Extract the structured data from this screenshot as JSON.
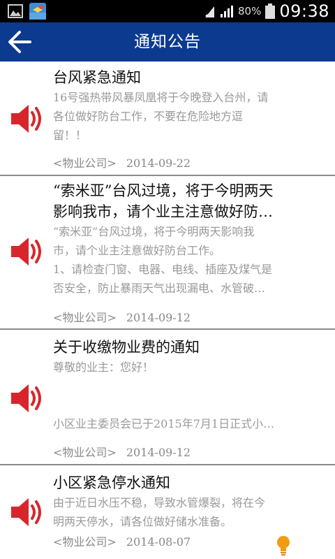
{
  "status_bar": {
    "battery_percent": "80%",
    "time": "09:38"
  },
  "app_bar": {
    "title": "通知公告",
    "back_icon": "arrow-left-icon"
  },
  "notices": [
    {
      "title": "台风紧急通知",
      "body_lines": [
        "16号强热带风暴凤凰将于今晚登入台州，请",
        "各位做好防台工作，不要在危险地方逗",
        "留！！"
      ],
      "source": "<物业公司>",
      "date": "2014-09-22"
    },
    {
      "title_lines": [
        "“索米亚”台风过境，将于今明两天",
        "影响我市，请个业主注意做好防…"
      ],
      "body_lines": [
        "“索米亚”台风过境，将于今明两天影响我",
        "市，请个业主注意做好防台工作。",
        "1、请检查门窗、电器、电线、插座及煤气是",
        "否安全，防止暴雨天气出现漏电、水管破…"
      ],
      "source": "<物业公司>",
      "date": "2014-09-12"
    },
    {
      "title": "关于收缴物业费的通知",
      "body_lines": [
        "尊敬的业主：您好！",
        "",
        "",
        "小区业主委员会已于2015年7月1日正式小…"
      ],
      "source": "<物业公司>",
      "date": "2014-09-12"
    },
    {
      "title": "小区紧急停水通知",
      "body_lines": [
        "由于近日水压不稳，导致水管爆裂，将在今",
        "明两天停水，请各位做好储水准备。"
      ],
      "source": "<物业公司>",
      "date": "2014-08-07"
    }
  ],
  "colors": {
    "app_bar": "#0b3a8f",
    "speaker_red": "#d7262b",
    "tip_orange": "#f39c12"
  }
}
